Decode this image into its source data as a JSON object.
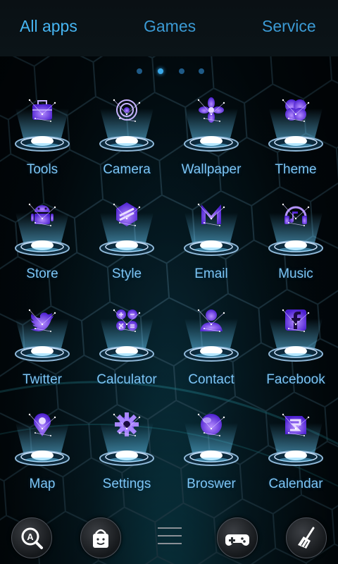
{
  "tabs": [
    {
      "label": "All apps",
      "active": true
    },
    {
      "label": "Games",
      "active": false
    },
    {
      "label": "Service",
      "active": false
    }
  ],
  "page_indicator": {
    "pages": 4,
    "current": 2
  },
  "apps": [
    {
      "label": "Tools",
      "icon": "toolbox-icon"
    },
    {
      "label": "Camera",
      "icon": "camera-lens-icon"
    },
    {
      "label": "Wallpaper",
      "icon": "flower-icon"
    },
    {
      "label": "Theme",
      "icon": "theme-circles-icon"
    },
    {
      "label": "Store",
      "icon": "android-icon"
    },
    {
      "label": "Style",
      "icon": "style-hexagon-icon"
    },
    {
      "label": "Email",
      "icon": "letter-m-icon"
    },
    {
      "label": "Music",
      "icon": "headphones-icon"
    },
    {
      "label": "Twitter",
      "icon": "bird-icon"
    },
    {
      "label": "Calculator",
      "icon": "calculator-icon"
    },
    {
      "label": "Contact",
      "icon": "person-icon"
    },
    {
      "label": "Facebook",
      "icon": "facebook-f-icon"
    },
    {
      "label": "Map",
      "icon": "map-pin-icon"
    },
    {
      "label": "Settings",
      "icon": "gear-icon"
    },
    {
      "label": "Broswer",
      "icon": "globe-icon"
    },
    {
      "label": "Calendar",
      "icon": "calendar-icon"
    }
  ],
  "dock": [
    {
      "name": "search-button",
      "icon": "search-a-icon"
    },
    {
      "name": "store-button",
      "icon": "android-bag-icon"
    },
    {
      "name": "menu-button",
      "icon": "hamburger-menu-icon"
    },
    {
      "name": "games-button",
      "icon": "gamepad-icon"
    },
    {
      "name": "clean-button",
      "icon": "broom-icon"
    }
  ],
  "colors": {
    "tab_text": "#3b9ad4",
    "label_text": "#7cc5f5",
    "icon_glow": "#7a4dff",
    "pedestal_glow": "#dff4ff"
  }
}
